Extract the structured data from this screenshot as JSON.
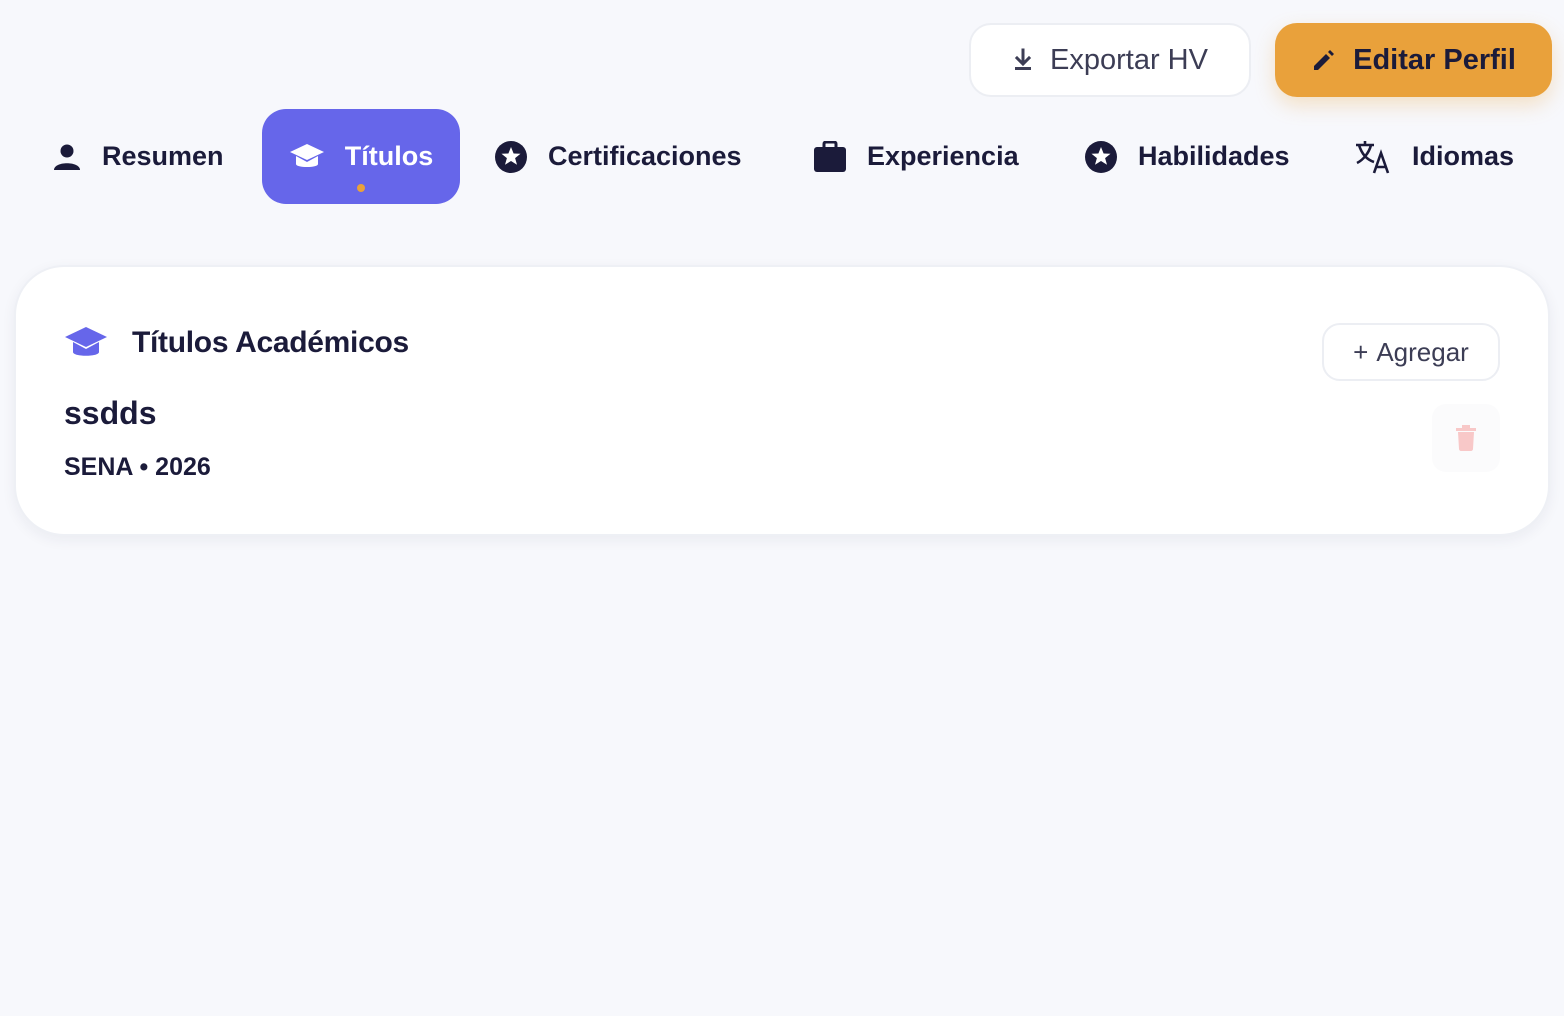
{
  "actions": {
    "export_label": "Exportar HV",
    "edit_label": "Editar Perfil"
  },
  "tabs": [
    {
      "label": "Resumen",
      "icon": "person-icon"
    },
    {
      "label": "Títulos",
      "icon": "graduation-cap-icon",
      "active": true
    },
    {
      "label": "Certificaciones",
      "icon": "star-circle-icon"
    },
    {
      "label": "Experiencia",
      "icon": "briefcase-icon"
    },
    {
      "label": "Habilidades",
      "icon": "star-circle-icon"
    },
    {
      "label": "Idiomas",
      "icon": "translate-icon"
    }
  ],
  "section": {
    "title": "Títulos Académicos",
    "add_label": "Agregar",
    "add_prefix": "+",
    "entries": [
      {
        "title": "ssdds",
        "meta": "SENA • 2026"
      }
    ]
  },
  "colors": {
    "accent": "#6666ea",
    "warning": "#e9a13b",
    "text": "#1b1b3a",
    "delete": "#f8c8c8"
  }
}
